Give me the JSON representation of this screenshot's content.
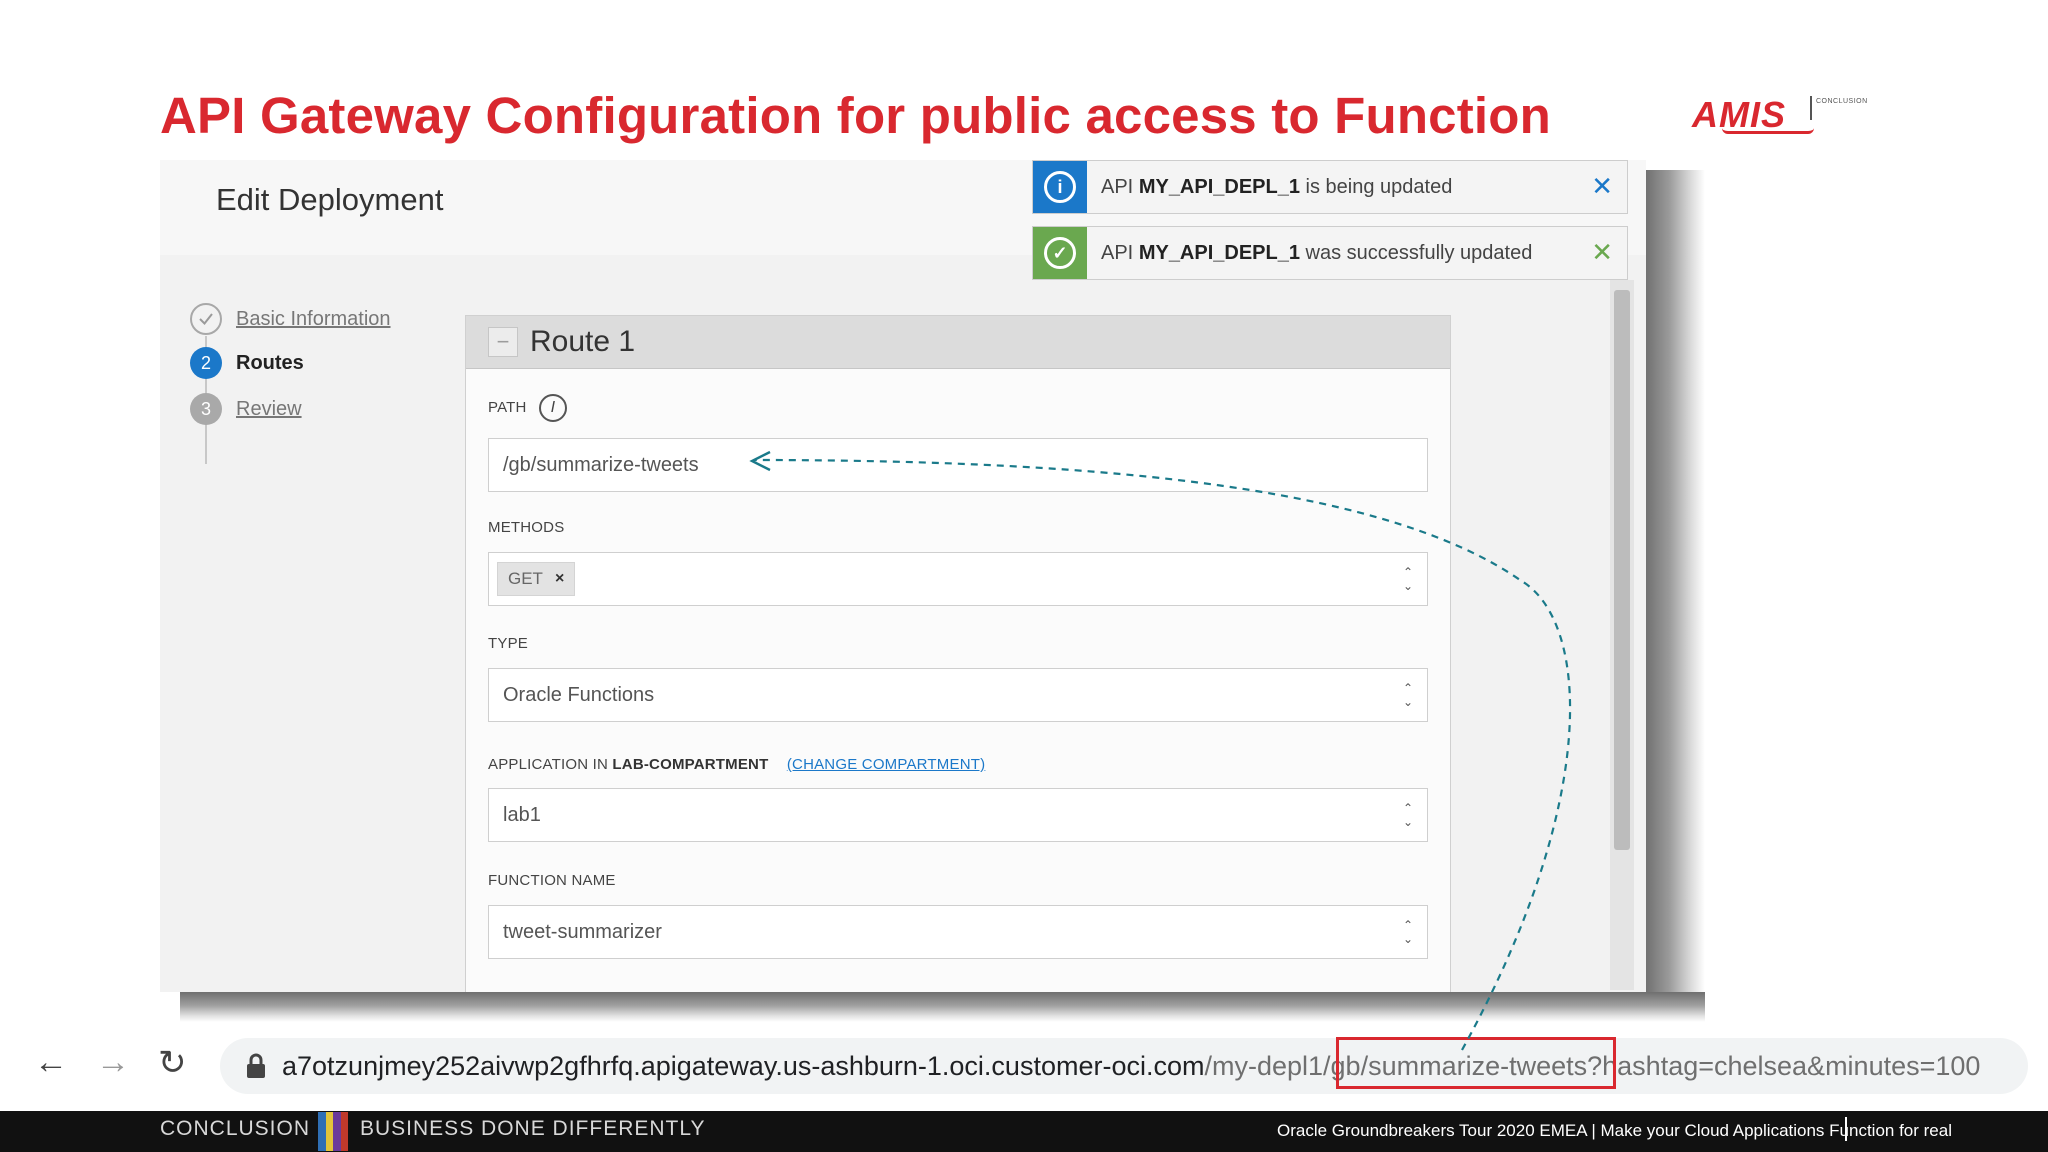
{
  "slide": {
    "title": "API Gateway Configuration for public access to Function",
    "logo": {
      "word": "AMIS",
      "tag": "CONCLUSION"
    }
  },
  "dialog": {
    "title": "Edit Deployment",
    "steps": [
      {
        "number": "",
        "label": "Basic Information",
        "state": "done"
      },
      {
        "number": "2",
        "label": "Routes",
        "state": "current"
      },
      {
        "number": "3",
        "label": "Review",
        "state": "future"
      }
    ],
    "route": {
      "title": "Route 1",
      "collapse_symbol": "−",
      "path_label": "PATH",
      "path_info_symbol": "i",
      "path_value": "/gb/summarize-tweets",
      "methods_label": "METHODS",
      "method_chip": "GET",
      "chip_remove": "×",
      "type_label": "TYPE",
      "type_value": "Oracle Functions",
      "app_label_prefix": "APPLICATION IN",
      "app_label_compartment": "LAB-COMPARTMENT",
      "change_compartment_link": "(CHANGE COMPARTMENT)",
      "app_value": "lab1",
      "function_label": "FUNCTION NAME",
      "function_value": "tweet-summarizer",
      "select_up": "⌃",
      "select_down": "⌄"
    }
  },
  "notifications": [
    {
      "type": "info",
      "icon": "i",
      "prefix": "API",
      "name": "MY_API_DEPL_1",
      "suffix": "is being updated",
      "close": "✕",
      "accent": "#1b78c9"
    },
    {
      "type": "success",
      "icon": "✓",
      "prefix": "API",
      "name": "MY_API_DEPL_1",
      "suffix": "was successfully updated",
      "close": "✕",
      "accent": "#6aa84f"
    }
  ],
  "browser": {
    "back": "←",
    "forward": "→",
    "reload": "↻",
    "url_host": "a7otzunjmey252aivwp2gfhrfq.apigateway.us-ashburn-1.oci.customer-oci.com",
    "url_deployment": "/my-depl1",
    "url_route": "/gb/summarize-tweets",
    "url_query": "?hashtag=chelsea&minutes=100"
  },
  "footer": {
    "left": "CONCLUSION",
    "middle": "BUSINESS DONE DIFFERENTLY",
    "right": "Oracle Groundbreakers Tour 2020 EMEA | Make your Cloud Applications Function for real"
  },
  "colors": {
    "title_red": "#d9282f",
    "info_blue": "#1b78c9",
    "success_green": "#6aa84f",
    "arrow_teal": "#1a7a8a",
    "stripes": [
      "#2f6fb5",
      "#e2c43a",
      "#6a3a9a",
      "#c0392b"
    ]
  }
}
